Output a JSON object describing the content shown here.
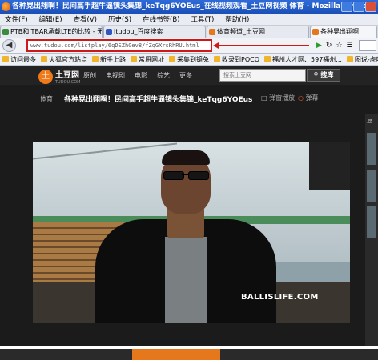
{
  "window": {
    "title": "各种晃出翔啊！民间高手超牛逼镜头集锦_keTqg6YOEus_在线视频观看_土豆网视频 体育 - Mozilla Firefox"
  },
  "menu": {
    "items": [
      "文件(F)",
      "编辑(E)",
      "查看(V)",
      "历史(S)",
      "在线书签(B)",
      "工具(T)",
      "帮助(H)"
    ]
  },
  "tabs": [
    {
      "label": "PTB和ITBAR承载LTE的比较 - 无...",
      "active": false,
      "favicon_color": "#3c8a3c"
    },
    {
      "label": "itudou_百度搜索",
      "active": false,
      "favicon_color": "#3255c4"
    },
    {
      "label": "体育频道_土豆网",
      "active": false,
      "favicon_color": "#e5771d"
    },
    {
      "label": "各种晃出翔啊",
      "active": true,
      "favicon_color": "#e5771d"
    }
  ],
  "navbar": {
    "url": "www.tudou.com/listplay/6qDSZhGev8/fZqGXrsRhRU.html"
  },
  "bookmarks": [
    "访问最多",
    "火狐官方站点",
    "新手上路",
    "常用网址",
    "采集到镜兔",
    "收录到POCO",
    "福州人才网、597福州...",
    "图说-虎嗅网"
  ],
  "site": {
    "logo_text": "土豆网",
    "logo_sub": "TUDOU.COM",
    "nav": [
      "原创",
      "电视剧",
      "电影",
      "综艺",
      "更多"
    ],
    "search_placeholder": "搜索土豆网",
    "search_button": "搜库"
  },
  "video": {
    "category": "体育",
    "title": "各种晃出翔啊！民间高手超牛逼镜头集锦_keTqg6YOEus",
    "small_window": "弹窗播放",
    "danmu": "弹幕",
    "watermark": "BALLISLIFE.COM"
  },
  "sidebar": {
    "label": "豆"
  }
}
